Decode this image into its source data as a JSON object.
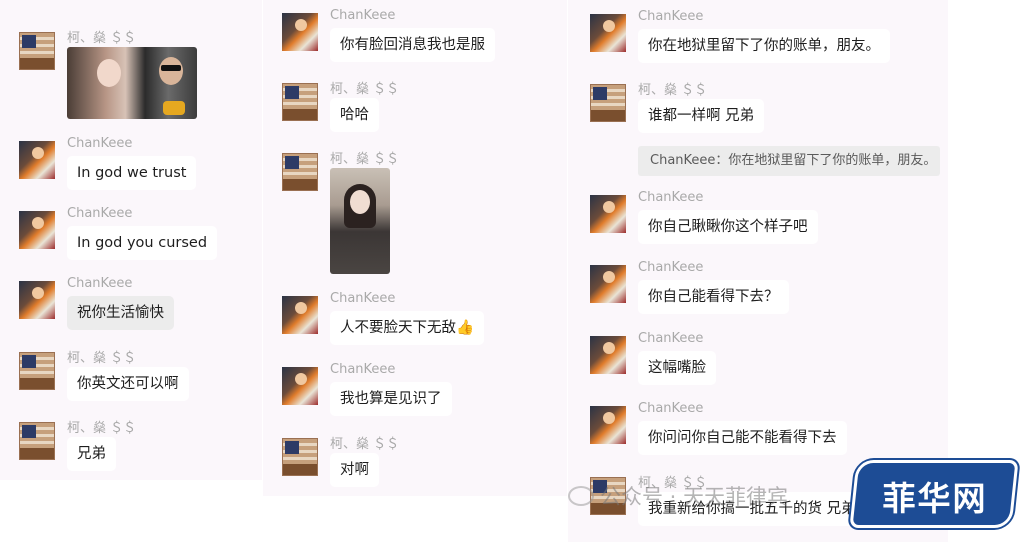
{
  "column1": {
    "messages": [
      {
        "sender": "柯、燊 ＄＄",
        "image": "couple-photo"
      },
      {
        "sender": "ChanKeee",
        "text": "In god we trust"
      },
      {
        "sender": "ChanKeee",
        "text": "In god you cursed"
      },
      {
        "sender": "ChanKeee",
        "text": "祝你生活愉快"
      },
      {
        "sender": "柯、燊 ＄＄",
        "text": "你英文还可以啊"
      },
      {
        "sender": "柯、燊 ＄＄",
        "text": "兄弟"
      }
    ]
  },
  "column2": {
    "messages": [
      {
        "sender": "ChanKeee",
        "text": "你有脸回消息我也是服"
      },
      {
        "sender": "柯、燊 ＄＄",
        "text": "哈哈"
      },
      {
        "sender": "柯、燊 ＄＄",
        "image": "girl-photo"
      },
      {
        "sender": "ChanKeee",
        "text": "人不要脸天下无敌👍"
      },
      {
        "sender": "ChanKeee",
        "text": "我也算是见识了"
      },
      {
        "sender": "柯、燊 ＄＄",
        "text": "对啊"
      }
    ]
  },
  "column3": {
    "messages": [
      {
        "sender": "ChanKeee",
        "text": "你在地狱里留下了你的账单，朋友。"
      },
      {
        "sender": "柯、燊 ＄＄",
        "text": "谁都一样啊 兄弟"
      },
      {
        "sender": "ChanKeee",
        "text": "你自己瞅瞅你这个样子吧"
      },
      {
        "sender": "ChanKeee",
        "text": "你自己能看得下去？"
      },
      {
        "sender": "ChanKeee",
        "text": "这幅嘴脸"
      },
      {
        "sender": "ChanKeee",
        "text": "你问问你自己能不能看得下去"
      },
      {
        "sender": "柯、燊 ＄＄",
        "text": "我重新给你搞一批五千的货 兄弟"
      }
    ],
    "quote": "ChanKeee：你在地狱里留下了你的账单，朋友。"
  },
  "watermark": "公众号 · 天天菲律宾",
  "brand": "菲华网",
  "colors": {
    "background": "#fbf7fb",
    "bubble": "#ffffff",
    "quote": "#ececec",
    "brand": "#1d4c95"
  }
}
